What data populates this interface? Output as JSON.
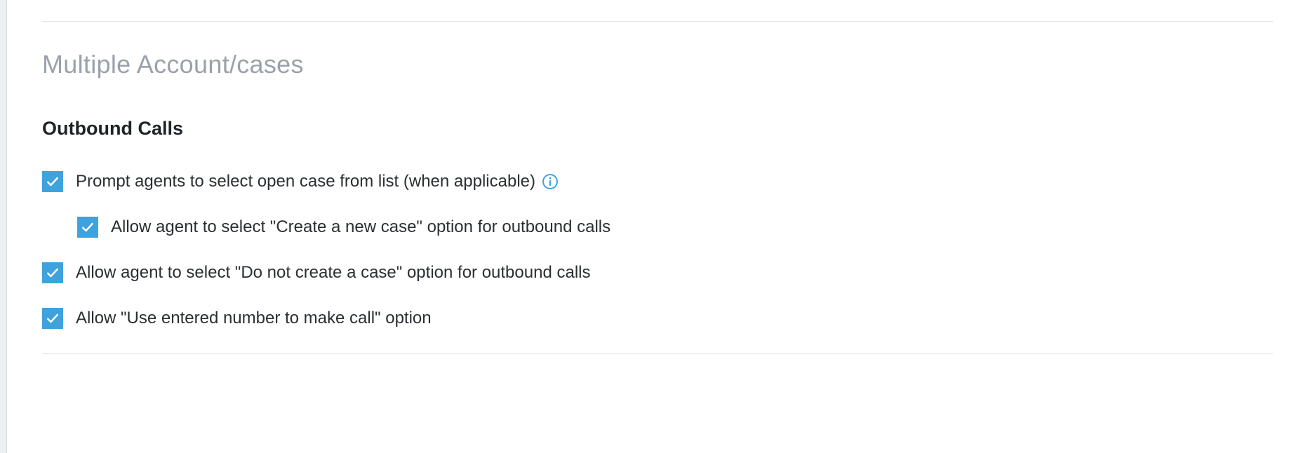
{
  "section": {
    "title": "Multiple Account/cases"
  },
  "subsection": {
    "title": "Outbound Calls"
  },
  "options": {
    "prompt_select_open_case": {
      "label": "Prompt agents to select open case from list (when applicable)",
      "checked": true,
      "has_info": true
    },
    "allow_create_new_case": {
      "label": "Allow agent to select \"Create a new case\" option for outbound calls",
      "checked": true,
      "nested": true
    },
    "allow_do_not_create_case": {
      "label": "Allow agent to select \"Do not create a case\" option for outbound calls",
      "checked": true
    },
    "allow_use_entered_number": {
      "label": "Allow \"Use entered number to make call\" option",
      "checked": true
    }
  }
}
